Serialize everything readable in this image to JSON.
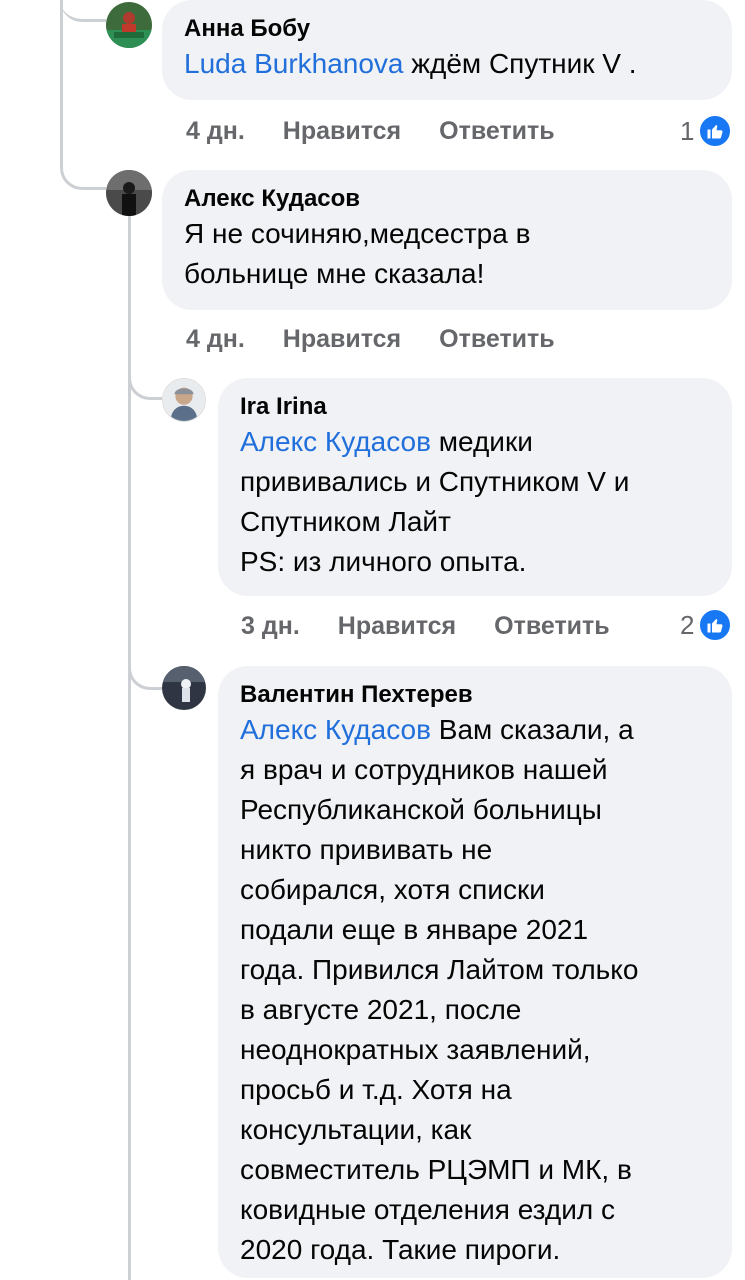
{
  "comments": [
    {
      "author": "Анна Бобу",
      "mention": "Luda Burkhanova",
      "text": " ждём Спутник V .",
      "time": "4 дн.",
      "like_label": "Нравится",
      "reply_label": "Ответить",
      "reactions": "1"
    },
    {
      "author": "Алекс Кудасов",
      "text": "Я не сочиняю,медсестра в\nбольнице мне сказала!",
      "time": "4 дн.",
      "like_label": "Нравится",
      "reply_label": "Ответить"
    },
    {
      "author": "Ira Irina",
      "mention": "Алекс Кудасов",
      "text": " медики\nпрививались и Спутником V и\nСпутником Лайт\nPS: из личного опыта.",
      "time": "3 дн.",
      "like_label": "Нравится",
      "reply_label": "Ответить",
      "reactions": "2"
    },
    {
      "author": "Валентин Пехтерев",
      "mention": "Алекс Кудасов",
      "text": " Вам сказали, а\nя врач и сотрудников нашей\nРеспубликанской больницы\nникто прививать не\nсобирался, хотя списки\nподали еще в январе 2021\nгода. Привился Лайтом только\nв августе 2021, после\nнеоднократных заявлений,\nпросьб и т.д. Хотя на\nконсультации, как\nсовместитель РЦЭМП и МК, в\nковидные отделения ездил с\n2020 года. Такие пироги."
    }
  ],
  "colors": {
    "bubble": "#f0f2f5",
    "mention": "#216fdb",
    "meta": "#65676b",
    "like_badge": "#1877f2",
    "thread": "#ccd0d5"
  },
  "icons": {
    "like": "thumbs-up-icon"
  }
}
